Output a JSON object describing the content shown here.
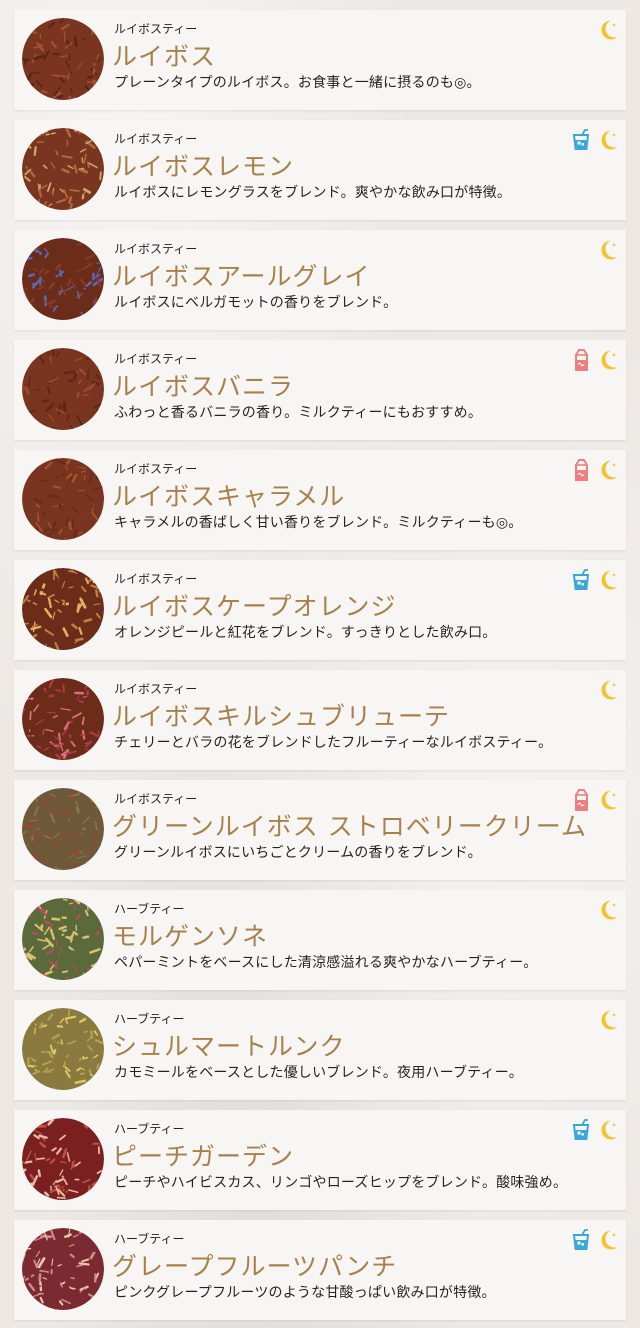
{
  "items": [
    {
      "category": "ルイボスティー",
      "name": "ルイボス",
      "desc": "プレーンタイプのルイボス。お食事と一緒に摂るのも◎。",
      "icons": [
        "moon-icon"
      ],
      "colors": [
        "#7a3520",
        "#a4522e",
        "#5a2414"
      ]
    },
    {
      "category": "ルイボスティー",
      "name": "ルイボスレモン",
      "desc": "ルイボスにレモングラスをブレンド。爽やかな飲み口が特徴。",
      "icons": [
        "iced-drink-icon",
        "moon-icon"
      ],
      "colors": [
        "#7a3520",
        "#b06a3a",
        "#c9a86a"
      ]
    },
    {
      "category": "ルイボスティー",
      "name": "ルイボスアールグレイ",
      "desc": "ルイボスにベルガモットの香りをブレンド。",
      "icons": [
        "moon-icon"
      ],
      "colors": [
        "#6b2c1a",
        "#8a3c22",
        "#5a66b8"
      ]
    },
    {
      "category": "ルイボスティー",
      "name": "ルイボスバニラ",
      "desc": "ふわっと香るバニラの香り。ミルクティーにもおすすめ。",
      "icons": [
        "milk-carton-icon",
        "moon-icon"
      ],
      "colors": [
        "#7a3520",
        "#9c4a2a",
        "#5e2616"
      ]
    },
    {
      "category": "ルイボスティー",
      "name": "ルイボスキャラメル",
      "desc": "キャラメルの香ばしく甘い香りをブレンド。ミルクティーも◎。",
      "icons": [
        "milk-carton-icon",
        "moon-icon"
      ],
      "colors": [
        "#7a3520",
        "#a4522e",
        "#6a2a18"
      ]
    },
    {
      "category": "ルイボスティー",
      "name": "ルイボスケープオレンジ",
      "desc": "オレンジピールと紅花をブレンド。すっきりとした飲み口。",
      "icons": [
        "iced-drink-icon",
        "moon-icon"
      ],
      "colors": [
        "#6b2c1a",
        "#c08040",
        "#e0b060"
      ]
    },
    {
      "category": "ルイボスティー",
      "name": "ルイボスキルシュブリューテ",
      "desc": "チェリーとバラの花をブレンドしたフルーティーなルイボスティー。",
      "icons": [
        "moon-icon"
      ],
      "colors": [
        "#6b2c1a",
        "#b03848",
        "#d87080"
      ]
    },
    {
      "category": "ルイボスティー",
      "name": "グリーンルイボス ストロベリークリーム",
      "desc": "グリーンルイボスにいちごとクリームの香りをブレンド。",
      "icons": [
        "milk-carton-icon",
        "moon-icon"
      ],
      "colors": [
        "#6e5a3a",
        "#8a7448",
        "#a04030"
      ]
    },
    {
      "category": "ハーブティー",
      "name": "モルゲンソネ",
      "desc": "ペパーミントをベースにした清涼感溢れる爽やかなハーブティー。",
      "icons": [
        "moon-icon"
      ],
      "colors": [
        "#5a6a3a",
        "#d8c070",
        "#c04860"
      ]
    },
    {
      "category": "ハーブティー",
      "name": "シュルマートルンク",
      "desc": "カモミールをベースとした優しいブレンド。夜用ハーブティー。",
      "icons": [
        "moon-icon"
      ],
      "colors": [
        "#8a7a40",
        "#e0c860",
        "#b0a050"
      ]
    },
    {
      "category": "ハーブティー",
      "name": "ピーチガーデン",
      "desc": "ピーチやハイビスカス、リンゴやローズヒップをブレンド。酸味強め。",
      "icons": [
        "iced-drink-icon",
        "moon-icon"
      ],
      "colors": [
        "#7a2020",
        "#c05040",
        "#e8b8a0"
      ]
    },
    {
      "category": "ハーブティー",
      "name": "グレープフルーツパンチ",
      "desc": "ピンクグレープフルーツのような甘酸っぱい飲み口が特徴。",
      "icons": [
        "iced-drink-icon",
        "moon-icon"
      ],
      "colors": [
        "#7a2a30",
        "#d08890",
        "#e8c8a8"
      ]
    }
  ],
  "icon_colors": {
    "moon": "#f2c230",
    "iced": "#3aa7d8",
    "milk": "#ef7f7f"
  }
}
